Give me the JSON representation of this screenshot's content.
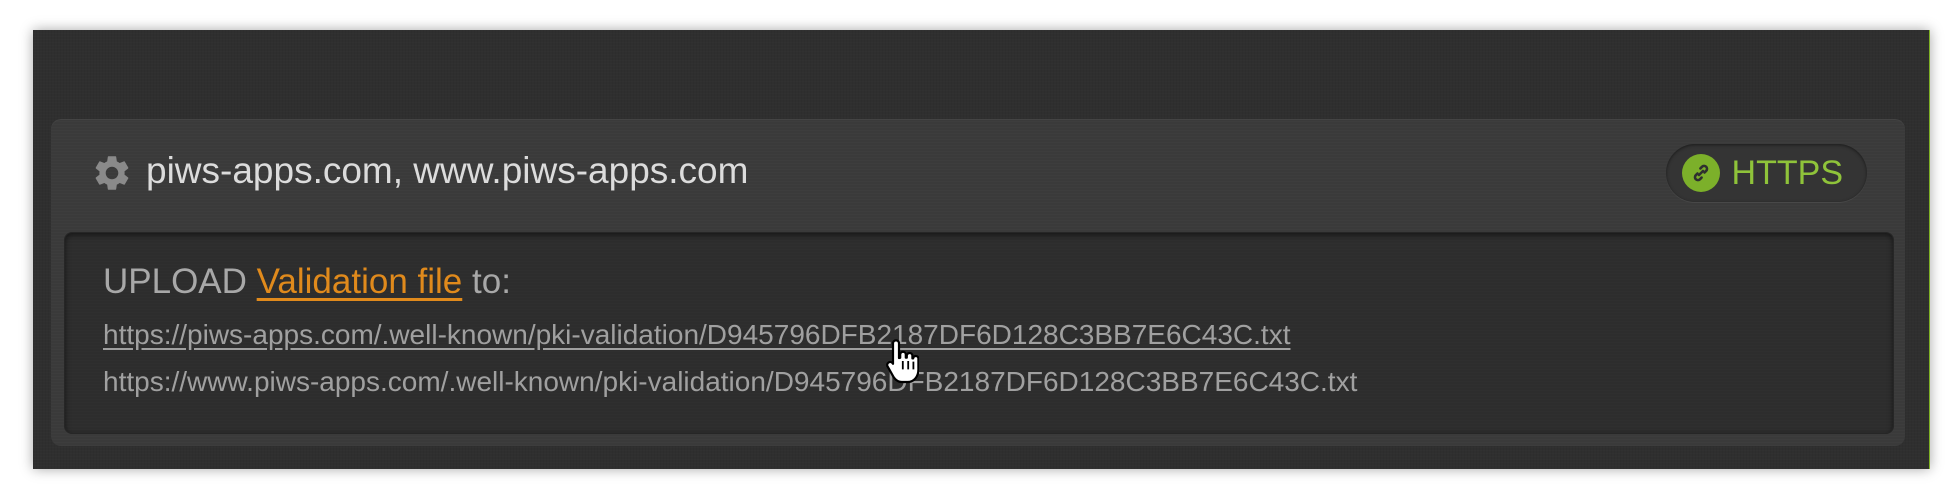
{
  "card": {
    "domains_title": "piws-apps.com, www.piws-apps.com",
    "badge": {
      "label": "HTTPS",
      "icon": "link-icon",
      "color": "#8fc33a"
    },
    "settings_icon": "gear-icon"
  },
  "upload": {
    "prefix": "UPLOAD",
    "link_text": "Validation file",
    "suffix": "to:",
    "link_color": "#e08a1c"
  },
  "urls": [
    "https://piws-apps.com/.well-known/pki-validation/D945796DFB2187DF6D128C3BB7E6C43C.txt",
    "https://www.piws-apps.com/.well-known/pki-validation/D945796DFB2187DF6D128C3BB7E6C43C.txt"
  ],
  "cursor": {
    "icon": "hand-pointer-icon"
  }
}
